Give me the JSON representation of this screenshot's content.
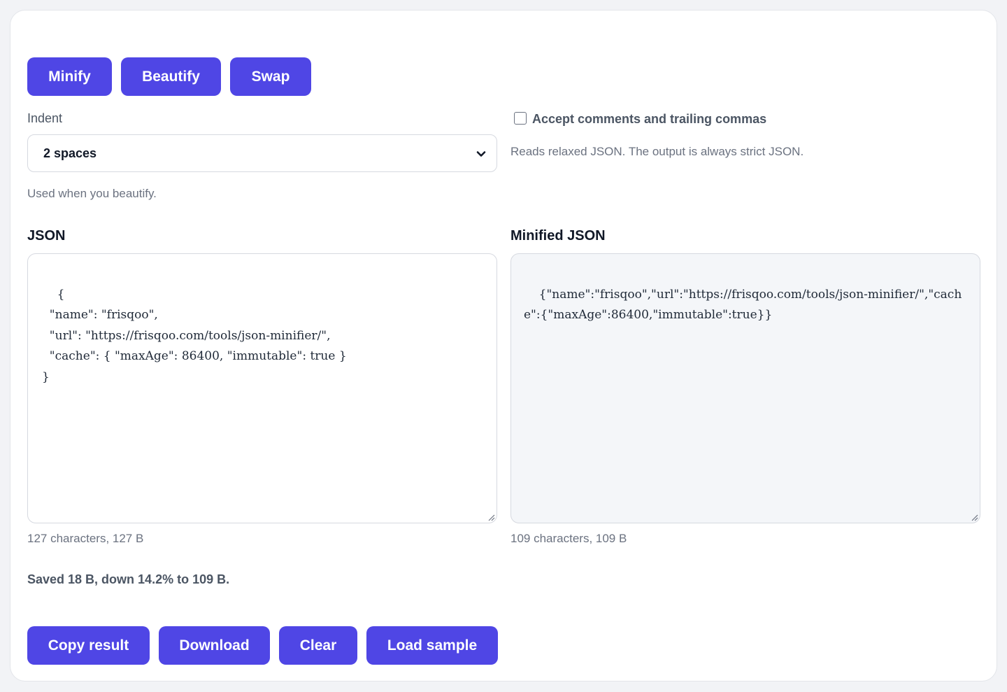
{
  "toolbar": {
    "minify": "Minify",
    "beautify": "Beautify",
    "swap": "Swap"
  },
  "indent": {
    "label": "Indent",
    "selected": "2 spaces",
    "help": "Used when you beautify."
  },
  "relaxed": {
    "checked": false,
    "label": "Accept comments and trailing commas",
    "help": "Reads relaxed JSON. The output is always strict JSON."
  },
  "input": {
    "title": "JSON",
    "value": "{\n  \"name\": \"frisqoo\",\n  \"url\": \"https://frisqoo.com/tools/json-minifier/\",\n  \"cache\": { \"maxAge\": 86400, \"immutable\": true }\n}",
    "stats": "127 characters, 127 B"
  },
  "output": {
    "title": "Minified JSON",
    "value": "{\"name\":\"frisqoo\",\"url\":\"https://frisqoo.com/tools/json-minifier/\",\"cache\":{\"maxAge\":86400,\"immutable\":true}}",
    "stats": "109 characters, 109 B"
  },
  "savings": "Saved 18 B, down 14.2% to 109 B.",
  "actions": {
    "copy": "Copy result",
    "download": "Download",
    "clear": "Clear",
    "load_sample": "Load sample"
  },
  "colors": {
    "accent": "#4f46e5",
    "output_bg": "#f4f6f9"
  },
  "icons": {
    "select_chevron": "chevron-down-icon",
    "resize_grip": "resize-grip-icon"
  }
}
